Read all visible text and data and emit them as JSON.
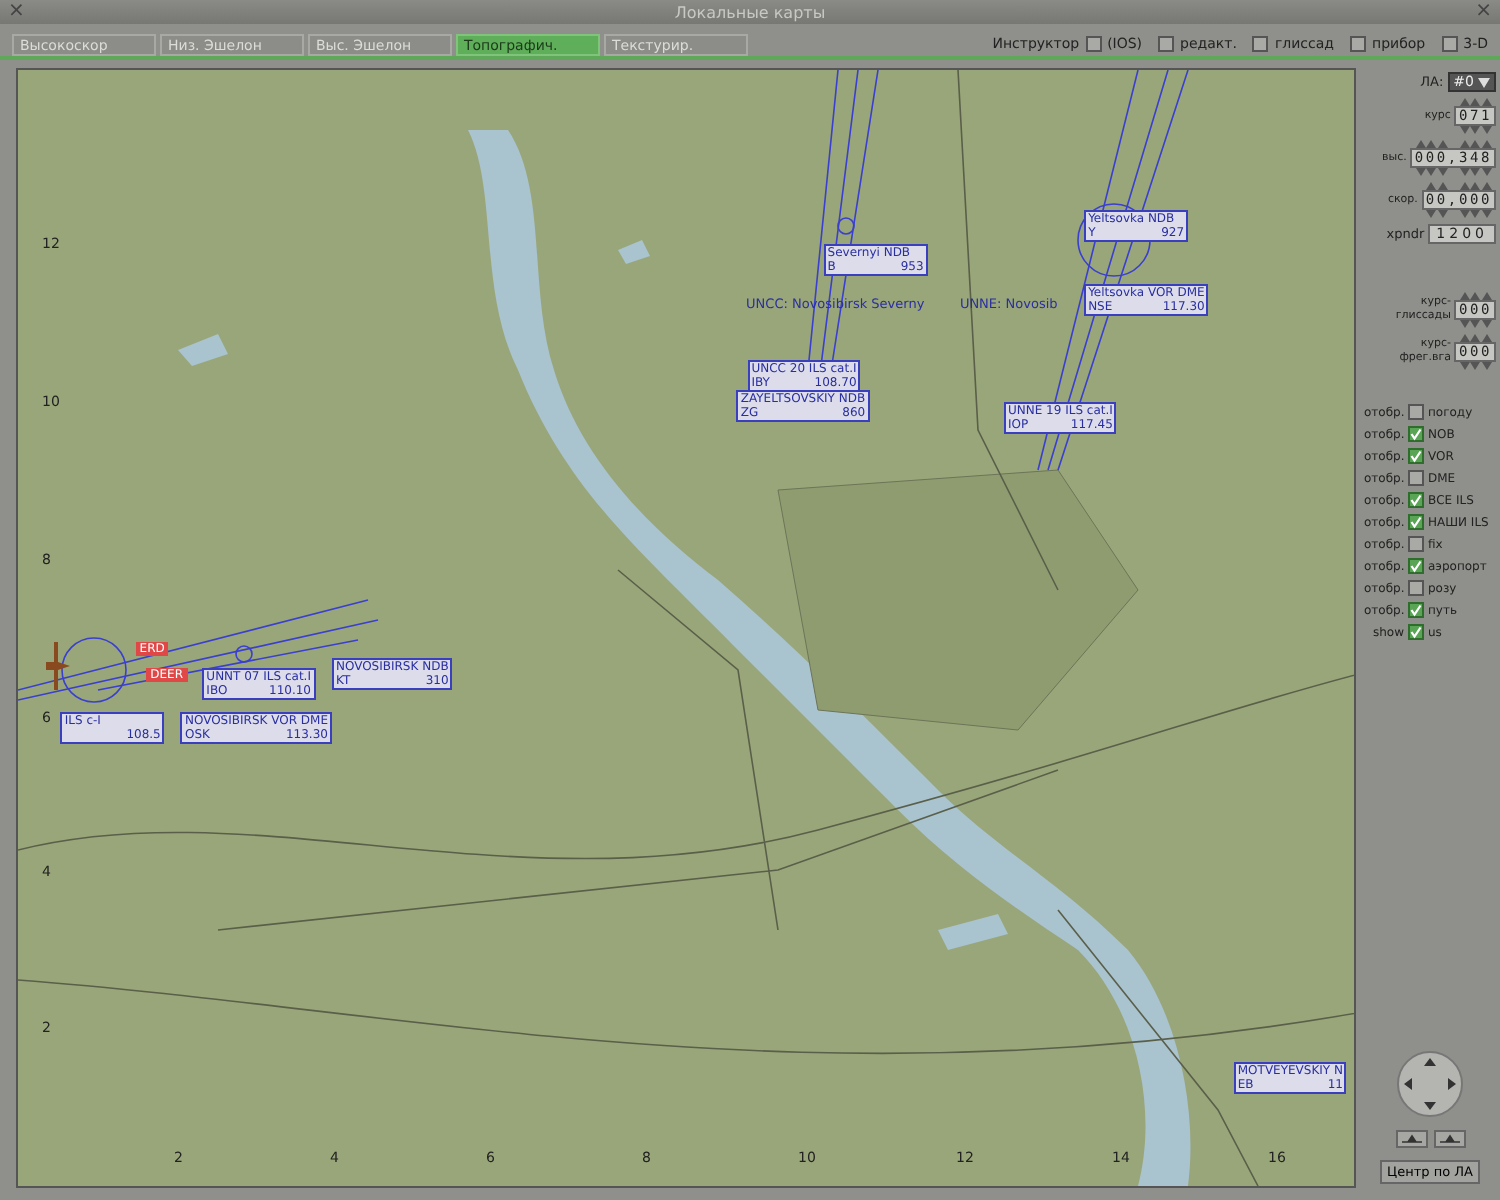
{
  "window": {
    "title": "Локальные карты",
    "close_left": "×",
    "close_right": "×"
  },
  "tabs": [
    {
      "label": "Высокоскор",
      "selected": false
    },
    {
      "label": "Низ. Эшелон",
      "selected": false
    },
    {
      "label": "Выс. Эшелон",
      "selected": false
    },
    {
      "label": "Топографич.",
      "selected": true
    },
    {
      "label": "Текстурир.",
      "selected": false
    }
  ],
  "instructor_label": "Инструктор",
  "toggles": [
    {
      "label": "(IOS)",
      "checked": false
    },
    {
      "label": "редакт.",
      "checked": false
    },
    {
      "label": "глиссад",
      "checked": false
    },
    {
      "label": "прибор",
      "checked": false
    },
    {
      "label": "3-D",
      "checked": false
    }
  ],
  "map": {
    "y_ticks": [
      "12",
      "10",
      "8",
      "6",
      "4",
      "2"
    ],
    "x_ticks": [
      "2",
      "4",
      "6",
      "8",
      "10",
      "12",
      "14",
      "16"
    ],
    "labels": [
      {
        "kind": "text",
        "text": "UNCC: Novosibirsk Severny"
      },
      {
        "kind": "text",
        "text": "UNNE: Novosib"
      },
      {
        "kind": "beacon",
        "name": "Severnyi NDB",
        "ident": "B",
        "freq": "953"
      },
      {
        "kind": "beacon",
        "name": "UNCC 20  ILS cat.I",
        "ident": "IBY",
        "freq": "108.70"
      },
      {
        "kind": "beacon",
        "name": "ZAYELTSOVSKIY NDB",
        "ident": "ZG",
        "freq": "860"
      },
      {
        "kind": "beacon",
        "name": "Yeltsovka NDB",
        "ident": "Y",
        "freq": "927"
      },
      {
        "kind": "beacon",
        "name": "Yeltsovka VOR DME",
        "ident": "NSE",
        "freq": "117.30"
      },
      {
        "kind": "beacon",
        "name": "UNNE 19  ILS cat.I",
        "ident": "IOP",
        "freq": "117.45"
      },
      {
        "kind": "beacon",
        "name": "NOVOSIBIRSK NDB",
        "ident": "KT",
        "freq": "310"
      },
      {
        "kind": "beacon",
        "name": "UNNT 07  ILS cat.I",
        "ident": "IBO",
        "freq": "110.10"
      },
      {
        "kind": "beacon",
        "name": "ILS c-I",
        "freq": "108.5"
      },
      {
        "kind": "beacon",
        "name": "NOVOSIBIRSK VOR DME",
        "ident": "OSK",
        "freq": "113.30"
      },
      {
        "kind": "beacon",
        "name": "MOTVEYEVSKIY N",
        "ident": "EB",
        "freq": "11"
      },
      {
        "kind": "fix",
        "text": "ERD"
      },
      {
        "kind": "fix",
        "text": "DEER"
      }
    ]
  },
  "panel": {
    "aircraft_label": "ЛА:",
    "aircraft": "#0",
    "spinners": [
      {
        "label": "курс",
        "value": "071"
      },
      {
        "label": "выс.",
        "value": "000,348"
      },
      {
        "label": "скор.",
        "value": "00,000"
      }
    ],
    "xpndr": {
      "label": "xpndr",
      "value": "1200"
    },
    "spinners2": [
      {
        "label": "курс- глиссады",
        "value": "000"
      },
      {
        "label": "курс- фрег.вга",
        "value": "000"
      }
    ],
    "layers": [
      {
        "prefix": "отобр.",
        "label": "погоду",
        "checked": false
      },
      {
        "prefix": "отобр.",
        "label": "NOB",
        "checked": true
      },
      {
        "prefix": "отобр.",
        "label": "VOR",
        "checked": true
      },
      {
        "prefix": "отобр.",
        "label": "DME",
        "checked": false
      },
      {
        "prefix": "отобр.",
        "label": "ВСЕ ILS",
        "checked": true
      },
      {
        "prefix": "отобр.",
        "label": "НАШИ ILS",
        "checked": true
      },
      {
        "prefix": "отобр.",
        "label": "fix",
        "checked": false
      },
      {
        "prefix": "отобр.",
        "label": "аэропорт",
        "checked": true
      },
      {
        "prefix": "отобр.",
        "label": "розу",
        "checked": false
      },
      {
        "prefix": "отобр.",
        "label": "путь",
        "checked": true
      },
      {
        "prefix": "show",
        "label": "us",
        "checked": true
      }
    ],
    "center_button": "Центр по ЛА"
  }
}
